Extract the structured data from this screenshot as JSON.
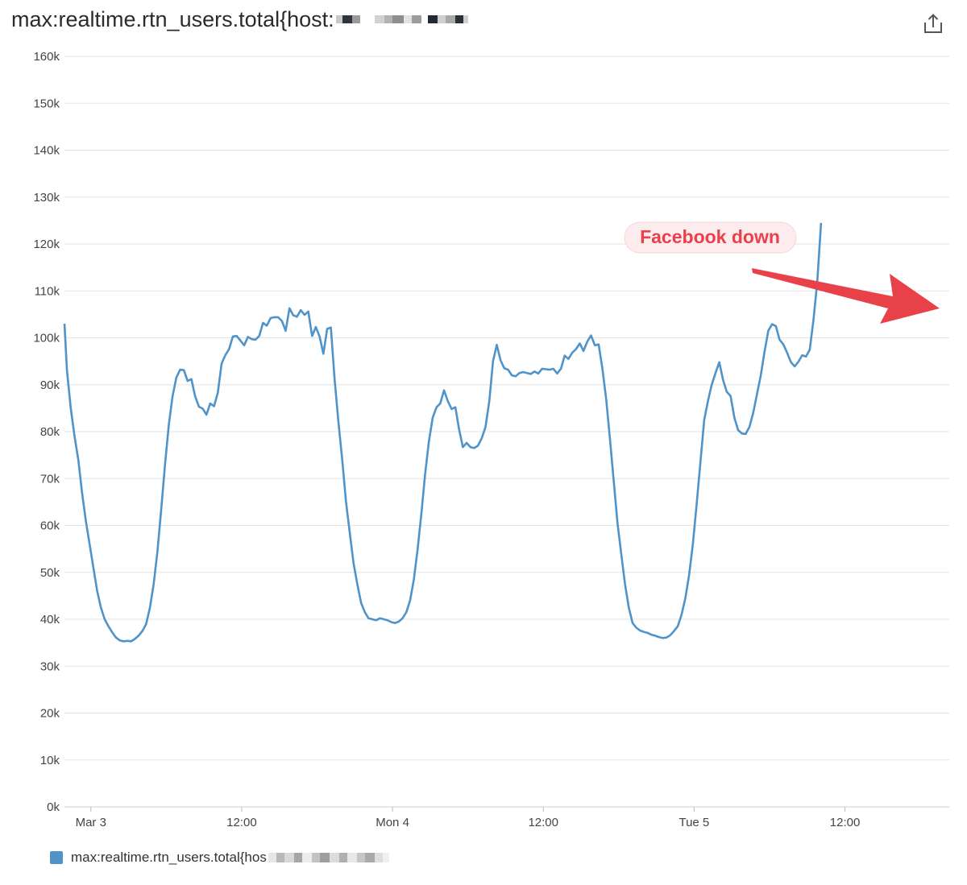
{
  "title": "max:realtime.rtn_users.total{host:",
  "export_icon": "export-icon",
  "legend": {
    "label": "max:realtime.rtn_users.total{hos",
    "color": "#4f93c8"
  },
  "colors": {
    "series": "#4f93c8",
    "annotation": "#e8414a",
    "annotation_bg": "#fdeced",
    "grid": "#e3e3e3"
  },
  "chart_data": {
    "type": "line",
    "title": "max:realtime.rtn_users.total{host:",
    "xlabel": "",
    "ylabel": "",
    "ylim": [
      0,
      160000
    ],
    "xlim": [
      0,
      68.4
    ],
    "x_unit": "hours since Mar 3 00:00",
    "yticks": [
      0,
      10000,
      20000,
      30000,
      40000,
      50000,
      60000,
      70000,
      80000,
      90000,
      100000,
      110000,
      120000,
      130000,
      140000,
      150000,
      160000
    ],
    "ytick_labels": [
      "0k",
      "10k",
      "20k",
      "30k",
      "40k",
      "50k",
      "60k",
      "70k",
      "80k",
      "90k",
      "100k",
      "110k",
      "120k",
      "130k",
      "140k",
      "150k",
      "160k"
    ],
    "xticks": [
      0,
      12,
      24,
      36,
      48,
      60
    ],
    "xtick_labels": [
      "Mar 3",
      "12:00",
      "Mon 4",
      "12:00",
      "Tue 5",
      "12:00"
    ],
    "grid": true,
    "legend_position": "bottom-left",
    "series": [
      {
        "name": "max:realtime.rtn_users.total{hos",
        "color": "#4f93c8",
        "points": [
          [
            -2.0,
            103000
          ],
          [
            -1.8,
            93000
          ],
          [
            -1.5,
            85000
          ],
          [
            -1.2,
            79000
          ],
          [
            -0.9,
            74000
          ],
          [
            -0.6,
            67000
          ],
          [
            -0.3,
            61000
          ],
          [
            0.0,
            56000
          ],
          [
            0.3,
            51000
          ],
          [
            0.6,
            46000
          ],
          [
            0.9,
            42500
          ],
          [
            1.2,
            40000
          ],
          [
            1.5,
            38500
          ],
          [
            1.8,
            37200
          ],
          [
            2.1,
            36100
          ],
          [
            2.4,
            35500
          ],
          [
            2.7,
            35300
          ],
          [
            3.0,
            35400
          ],
          [
            3.3,
            35300
          ],
          [
            3.6,
            35800
          ],
          [
            3.9,
            36500
          ],
          [
            4.2,
            37500
          ],
          [
            4.5,
            39000
          ],
          [
            4.8,
            42500
          ],
          [
            5.1,
            47500
          ],
          [
            5.4,
            54500
          ],
          [
            5.7,
            63500
          ],
          [
            6.0,
            73000
          ],
          [
            6.3,
            81500
          ],
          [
            6.6,
            87500
          ],
          [
            6.9,
            91500
          ],
          [
            7.2,
            93200
          ],
          [
            7.5,
            93100
          ],
          [
            7.8,
            90800
          ],
          [
            8.1,
            91200
          ],
          [
            8.4,
            87500
          ],
          [
            8.7,
            85300
          ],
          [
            9.0,
            84900
          ],
          [
            9.3,
            83600
          ],
          [
            9.6,
            86000
          ],
          [
            9.9,
            85400
          ],
          [
            10.2,
            88300
          ],
          [
            10.5,
            94500
          ],
          [
            10.8,
            96300
          ],
          [
            11.1,
            97600
          ],
          [
            11.4,
            100300
          ],
          [
            11.7,
            100400
          ],
          [
            12.0,
            99400
          ],
          [
            12.3,
            98400
          ],
          [
            12.6,
            100200
          ],
          [
            12.9,
            99700
          ],
          [
            13.2,
            99600
          ],
          [
            13.5,
            100400
          ],
          [
            13.8,
            103200
          ],
          [
            14.1,
            102600
          ],
          [
            14.4,
            104200
          ],
          [
            14.7,
            104400
          ],
          [
            15.0,
            104400
          ],
          [
            15.3,
            103600
          ],
          [
            15.6,
            101500
          ],
          [
            15.9,
            106300
          ],
          [
            16.2,
            104800
          ],
          [
            16.5,
            104500
          ],
          [
            16.8,
            105900
          ],
          [
            17.1,
            104900
          ],
          [
            17.4,
            105600
          ],
          [
            17.7,
            100400
          ],
          [
            18.0,
            102300
          ],
          [
            18.3,
            100300
          ],
          [
            18.6,
            96600
          ],
          [
            18.9,
            101900
          ],
          [
            19.2,
            102200
          ],
          [
            19.5,
            91000
          ],
          [
            19.8,
            82000
          ],
          [
            20.1,
            74000
          ],
          [
            20.4,
            65000
          ],
          [
            20.7,
            58500
          ],
          [
            21.0,
            52000
          ],
          [
            21.3,
            47500
          ],
          [
            21.6,
            43500
          ],
          [
            21.9,
            41500
          ],
          [
            22.2,
            40200
          ],
          [
            22.5,
            40000
          ],
          [
            22.8,
            39800
          ],
          [
            23.1,
            40200
          ],
          [
            23.4,
            40000
          ],
          [
            23.7,
            39800
          ],
          [
            24.0,
            39400
          ],
          [
            24.3,
            39200
          ],
          [
            24.6,
            39500
          ],
          [
            24.9,
            40200
          ],
          [
            25.2,
            41500
          ],
          [
            25.5,
            44000
          ],
          [
            25.8,
            48500
          ],
          [
            26.1,
            55000
          ],
          [
            26.4,
            62500
          ],
          [
            26.7,
            71000
          ],
          [
            27.0,
            78000
          ],
          [
            27.3,
            83000
          ],
          [
            27.6,
            85200
          ],
          [
            27.9,
            86000
          ],
          [
            28.2,
            88800
          ],
          [
            28.5,
            86500
          ],
          [
            28.8,
            84800
          ],
          [
            29.1,
            85200
          ],
          [
            29.4,
            80500
          ],
          [
            29.7,
            76700
          ],
          [
            30.0,
            77600
          ],
          [
            30.3,
            76700
          ],
          [
            30.6,
            76500
          ],
          [
            30.9,
            77000
          ],
          [
            31.2,
            78600
          ],
          [
            31.5,
            81000
          ],
          [
            31.8,
            86500
          ],
          [
            32.1,
            95000
          ],
          [
            32.4,
            98500
          ],
          [
            32.7,
            95200
          ],
          [
            33.0,
            93500
          ],
          [
            33.3,
            93200
          ],
          [
            33.6,
            92000
          ],
          [
            33.9,
            91800
          ],
          [
            34.2,
            92500
          ],
          [
            34.5,
            92700
          ],
          [
            34.8,
            92500
          ],
          [
            35.1,
            92300
          ],
          [
            35.4,
            92800
          ],
          [
            35.7,
            92400
          ],
          [
            36.0,
            93400
          ],
          [
            36.3,
            93300
          ],
          [
            36.6,
            93200
          ],
          [
            36.9,
            93400
          ],
          [
            37.2,
            92400
          ],
          [
            37.5,
            93400
          ],
          [
            37.8,
            96200
          ],
          [
            38.1,
            95500
          ],
          [
            38.4,
            96800
          ],
          [
            38.7,
            97600
          ],
          [
            39.0,
            98800
          ],
          [
            39.3,
            97200
          ],
          [
            39.6,
            99200
          ],
          [
            39.9,
            100500
          ],
          [
            40.2,
            98400
          ],
          [
            40.5,
            98600
          ],
          [
            40.8,
            93500
          ],
          [
            41.1,
            87000
          ],
          [
            41.4,
            78500
          ],
          [
            41.7,
            69500
          ],
          [
            42.0,
            60500
          ],
          [
            42.3,
            54000
          ],
          [
            42.6,
            47500
          ],
          [
            42.9,
            42500
          ],
          [
            43.2,
            39200
          ],
          [
            43.5,
            38200
          ],
          [
            43.8,
            37600
          ],
          [
            44.1,
            37300
          ],
          [
            44.4,
            37100
          ],
          [
            44.7,
            36700
          ],
          [
            45.0,
            36500
          ],
          [
            45.3,
            36200
          ],
          [
            45.6,
            36000
          ],
          [
            45.9,
            36100
          ],
          [
            46.2,
            36600
          ],
          [
            46.5,
            37500
          ],
          [
            46.8,
            38500
          ],
          [
            47.1,
            41000
          ],
          [
            47.4,
            44500
          ],
          [
            47.7,
            49500
          ],
          [
            48.0,
            56000
          ],
          [
            48.3,
            64500
          ],
          [
            48.6,
            73500
          ],
          [
            48.9,
            82500
          ],
          [
            49.2,
            86500
          ],
          [
            49.5,
            90000
          ],
          [
            49.8,
            92500
          ],
          [
            50.1,
            94800
          ],
          [
            50.4,
            91000
          ],
          [
            50.7,
            88500
          ],
          [
            51.0,
            87600
          ],
          [
            51.3,
            83000
          ],
          [
            51.6,
            80300
          ],
          [
            51.9,
            79600
          ],
          [
            52.2,
            79500
          ],
          [
            52.5,
            81000
          ],
          [
            52.8,
            84000
          ],
          [
            53.1,
            88000
          ],
          [
            53.4,
            92000
          ],
          [
            53.7,
            97000
          ],
          [
            54.0,
            101500
          ],
          [
            54.3,
            102900
          ],
          [
            54.6,
            102500
          ],
          [
            54.9,
            99600
          ],
          [
            55.2,
            98600
          ],
          [
            55.5,
            96800
          ],
          [
            55.8,
            94800
          ],
          [
            56.1,
            93900
          ],
          [
            56.4,
            94900
          ],
          [
            56.7,
            96300
          ],
          [
            57.0,
            96000
          ],
          [
            57.3,
            97500
          ],
          [
            57.6,
            104000
          ],
          [
            57.9,
            112000
          ],
          [
            58.2,
            124500
          ]
        ]
      }
    ],
    "annotations": [
      {
        "text": "Facebook down"
      }
    ]
  }
}
